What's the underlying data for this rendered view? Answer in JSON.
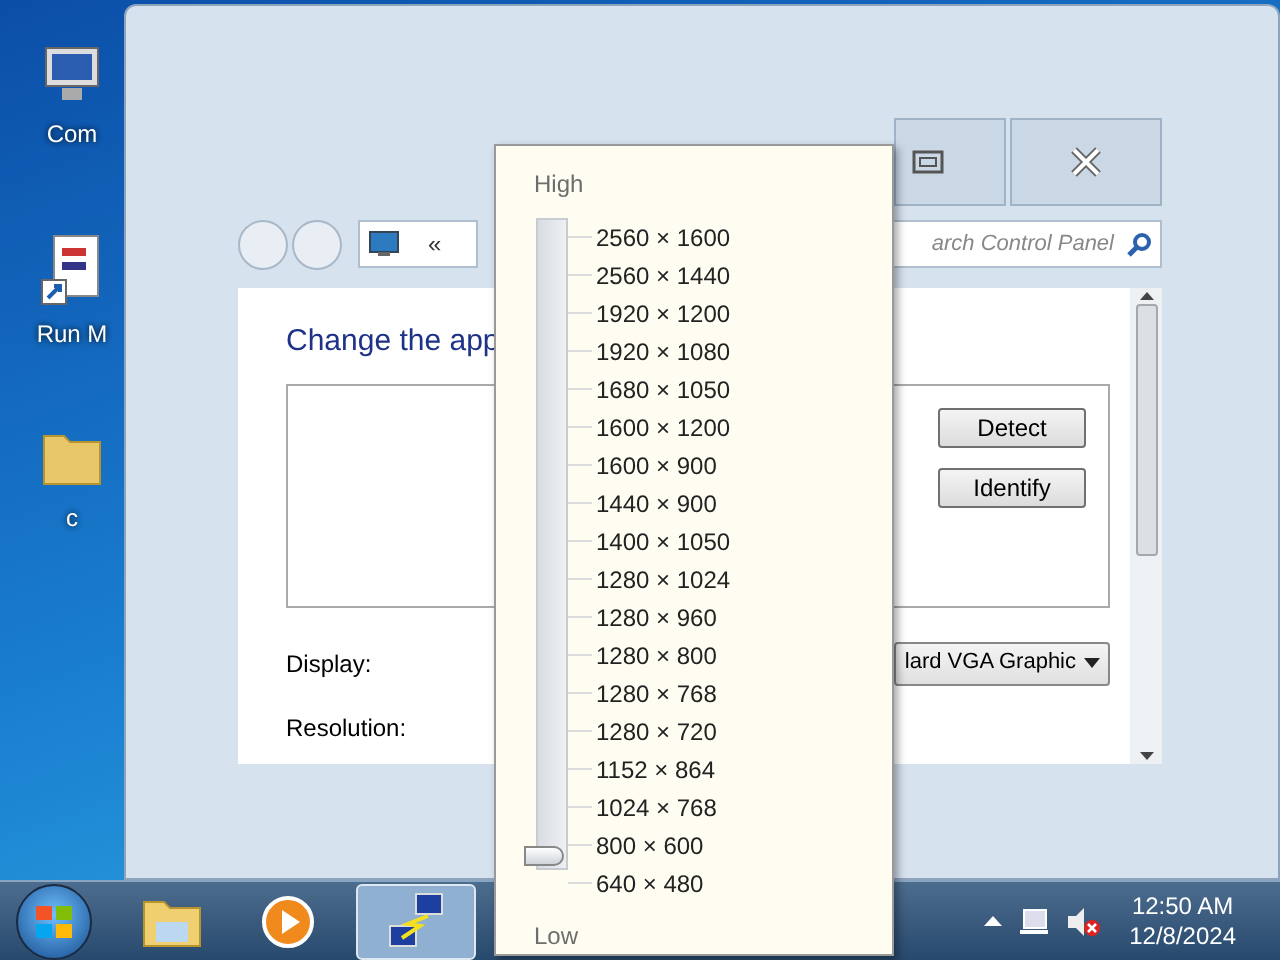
{
  "desktop_icons": [
    {
      "label": "Com",
      "kind": "computer"
    },
    {
      "label": "Run M",
      "kind": "shortcut"
    },
    {
      "label": "c",
      "kind": "folder"
    }
  ],
  "window": {
    "address_chevron": "«",
    "search": {
      "placeholder": "arch Control Panel"
    },
    "heading": "Change the app",
    "buttons": [
      "Detect",
      "Identify"
    ],
    "display": {
      "label": "Display:",
      "value": "lard VGA Graphic"
    },
    "resolution": {
      "label": "Resolution:"
    }
  },
  "resolution_popup": {
    "high_label": "High",
    "low_label": "Low",
    "level": 0,
    "options": [
      "2560 × 1600",
      "2560 × 1440",
      "1920 × 1200",
      "1920 × 1080",
      "1680 × 1050",
      "1600 × 1200",
      "1600 × 900",
      "1440 × 900",
      "1400 × 1050",
      "1280 × 1024",
      "1280 × 960",
      "1280 × 800",
      "1280 × 768",
      "1280 × 720",
      "1152 × 864",
      "1024 × 768",
      "800 × 600",
      "640 × 480"
    ]
  },
  "taskbar": {
    "apps": [
      {
        "kind": "explorer",
        "selected": false
      },
      {
        "kind": "media",
        "selected": false
      },
      {
        "kind": "remote",
        "selected": true
      }
    ],
    "clock": {
      "time": "12:50 AM",
      "date": "12/8/2024"
    }
  }
}
